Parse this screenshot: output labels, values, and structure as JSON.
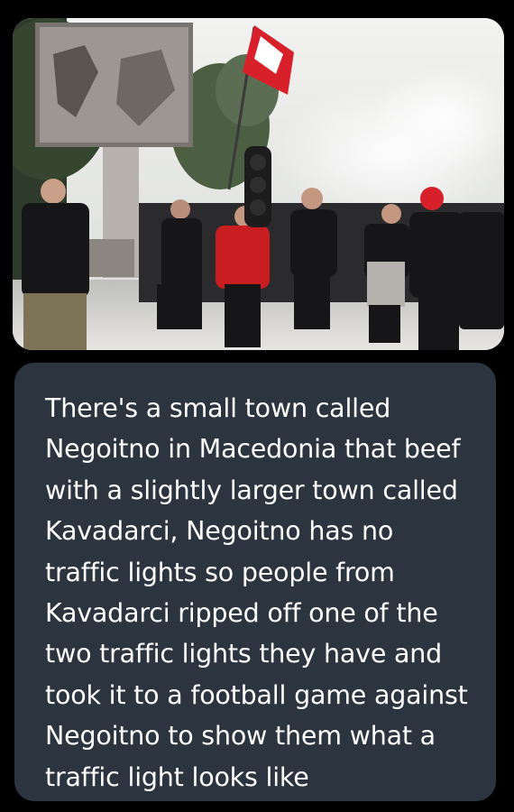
{
  "photo": {
    "alt_subject": "crowd-with-traffic-light"
  },
  "caption": {
    "text": "There's a small town called Negoitno in Macedonia that beef with a slightly larger town called Kavadarci, Negoitno has no traffic lights so people from Kavadarci ripped off one of the two traffic lights they have and took it to a football game against Negoitno to show them what a traffic light looks like"
  },
  "colors": {
    "background": "#000000",
    "bubble": "#2c3440",
    "text": "#ffffff",
    "flag_red": "#d8202a"
  }
}
